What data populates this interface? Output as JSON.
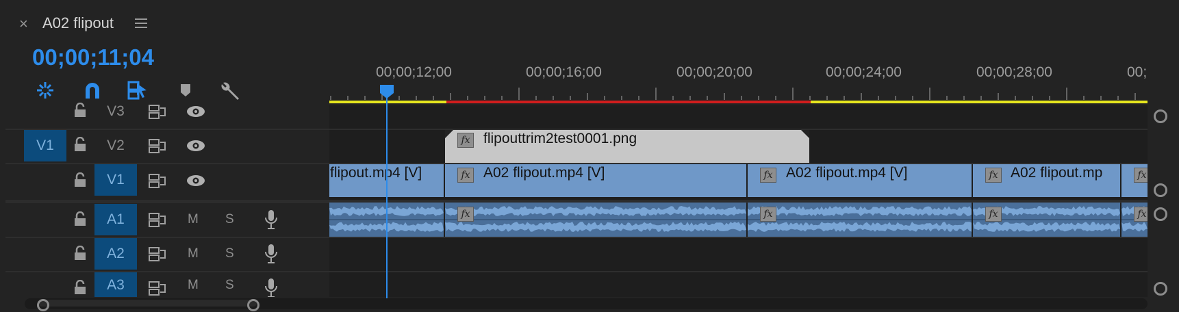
{
  "header": {
    "close_label": "×",
    "title": "A02 flipout",
    "timecode": "00;00;11;04"
  },
  "ruler": {
    "tick_labels": [
      "00;00;12;00",
      "00;00;16;00",
      "00;00;20;00",
      "00;00;24;00",
      "00;00;28;00",
      "00;"
    ]
  },
  "tracks": {
    "video": [
      {
        "name": "V3",
        "source_patch": "",
        "targeted": false
      },
      {
        "name": "V2",
        "source_patch": "V1",
        "targeted": false
      },
      {
        "name": "V1",
        "source_patch": "",
        "targeted": true
      }
    ],
    "audio": [
      {
        "name": "A1",
        "mute": "M",
        "solo": "S"
      },
      {
        "name": "A2",
        "mute": "M",
        "solo": "S"
      },
      {
        "name": "A3",
        "mute": "M",
        "solo": "S"
      }
    ]
  },
  "clips": {
    "v2": [
      {
        "label": "flipouttrim2test0001.png"
      }
    ],
    "v1": [
      {
        "label": "flipout.mp4 [V]"
      },
      {
        "label": "A02 flipout.mp4 [V]"
      },
      {
        "label": "A02 flipout.mp4 [V]"
      },
      {
        "label": "A02 flipout.mp"
      }
    ],
    "fx_label": "fx"
  },
  "colors": {
    "accent": "#2d8ceb",
    "video_clip": "#6f98c8",
    "image_clip": "#c7c7c7",
    "audio_clip": "#4a6f9a",
    "render_bar_yellow": "#e6e61e",
    "render_bar_red": "#d01d1d"
  },
  "icons": {
    "toolbar": [
      "insert-overwrite-sequences-icon",
      "snap-magnet-icon",
      "linked-selection-icon",
      "add-marker-icon",
      "wrench-icon"
    ]
  }
}
